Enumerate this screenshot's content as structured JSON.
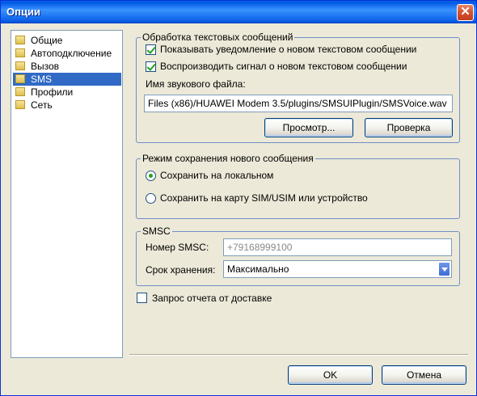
{
  "window": {
    "title": "Опции",
    "close_glyph": "✕"
  },
  "tree": {
    "items": [
      {
        "label": "Общие"
      },
      {
        "label": "Автоподключение"
      },
      {
        "label": "Вызов"
      },
      {
        "label": "SMS",
        "selected": true
      },
      {
        "label": "Профили"
      },
      {
        "label": "Сеть"
      }
    ]
  },
  "sms_processing": {
    "legend": "Обработка текстовых сообщений",
    "show_notification": {
      "label": "Показывать уведомление о новом текстовом сообщении",
      "checked": true
    },
    "play_sound": {
      "label": "Воспроизводить сигнал о новом текстовом сообщении",
      "checked": true
    },
    "sound_file_label": "Имя звукового файла:",
    "sound_file_value": "Files (x86)/HUAWEI Modem 3.5/plugins/SMSUIPlugin/SMSVoice.wav",
    "browse_label": "Просмотр...",
    "test_label": "Проверка"
  },
  "save_mode": {
    "legend": "Режим сохранения нового сообщения",
    "local": {
      "label": "Сохранить на локальном",
      "selected": true
    },
    "sim": {
      "label": "Сохранить на карту SIM/USIM  или устройство",
      "selected": false
    }
  },
  "smsc": {
    "legend": "SMSC",
    "number_label": "Номер SMSC:",
    "number_value": "+79168999100",
    "validity_label": "Срок хранения:",
    "validity_value": "Максимально"
  },
  "delivery_report": {
    "label": "Запрос отчета от доставке",
    "checked": false
  },
  "footer": {
    "ok_label": "OK",
    "cancel_label": "Отмена"
  }
}
